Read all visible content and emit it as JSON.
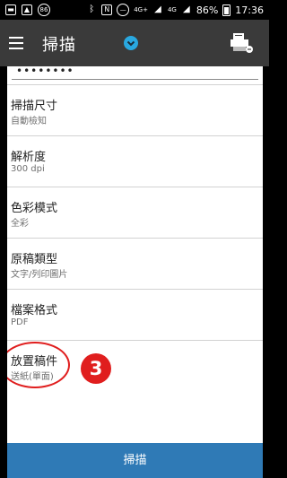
{
  "status_bar": {
    "nfc_label": "N",
    "network_label": "4G+",
    "network_label_2": "4G",
    "battery": "86%",
    "time": "17:36",
    "badge_count": "86"
  },
  "app_bar": {
    "title": "掃描"
  },
  "settings": {
    "partial_value": "••••••••",
    "items": [
      {
        "label": "掃描尺寸",
        "value": "自動檢知"
      },
      {
        "label": "解析度",
        "value": "300 dpi"
      },
      {
        "label": "色彩模式",
        "value": "全彩"
      },
      {
        "label": "原稿類型",
        "value": "文字/列印圖片"
      },
      {
        "label": "檔案格式",
        "value": "PDF"
      },
      {
        "label": "放置稿件",
        "value": "送紙(單面)"
      }
    ]
  },
  "annotation": {
    "step_number": "3",
    "color": "#e01e1e"
  },
  "scan_button": {
    "label": "掃描"
  },
  "colors": {
    "app_bar": "#3a3a3a",
    "accent": "#29a8e0",
    "scan_button": "#2f7ab6"
  }
}
